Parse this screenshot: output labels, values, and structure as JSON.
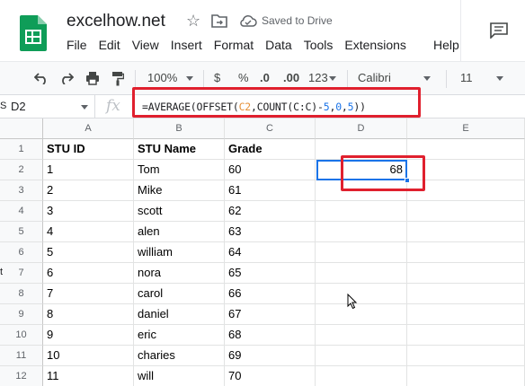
{
  "app": {
    "doc_title": "excelhow.net",
    "save_status": "Saved to Drive"
  },
  "menu": [
    "File",
    "Edit",
    "View",
    "Insert",
    "Format",
    "Data",
    "Tools",
    "Extensions"
  ],
  "menu_help": "Help",
  "toolbar": {
    "zoom": "100%",
    "currency": "$",
    "percent": "%",
    "decrease_decimal": ".0",
    "increase_decimal": ".00",
    "number_format": "123",
    "font": "Calibri",
    "font_size": "11"
  },
  "formula_bar": {
    "name_box": "D2",
    "fx": "fx",
    "formula_parts": {
      "p1": "=AVERAGE(OFFSET(",
      "p2": "C2",
      "p3": ",COUNT(C:C)-",
      "p4": "5",
      "p5": ",",
      "p6": "0",
      "p7": ",",
      "p8": "5",
      "p9": "))"
    }
  },
  "columns": [
    "A",
    "B",
    "C",
    "D",
    "E"
  ],
  "rows": [
    "1",
    "2",
    "3",
    "4",
    "5",
    "6",
    "7",
    "8",
    "9",
    "10",
    "11",
    "12"
  ],
  "cells": [
    [
      "STU ID",
      "STU Name",
      "Grade",
      "",
      ""
    ],
    [
      "1",
      "Tom",
      "60",
      "68",
      ""
    ],
    [
      "2",
      "Mike",
      "61",
      "",
      ""
    ],
    [
      "3",
      "scott",
      "62",
      "",
      ""
    ],
    [
      "4",
      "alen",
      "63",
      "",
      ""
    ],
    [
      "5",
      "william",
      "64",
      "",
      ""
    ],
    [
      "6",
      "nora",
      "65",
      "",
      ""
    ],
    [
      "7",
      "carol",
      "66",
      "",
      ""
    ],
    [
      "8",
      "daniel",
      "67",
      "",
      ""
    ],
    [
      "9",
      "eric",
      "68",
      "",
      ""
    ],
    [
      "10",
      "charies",
      "69",
      "",
      ""
    ],
    [
      "11",
      "will",
      "70",
      "",
      ""
    ]
  ],
  "edge_fragments": {
    "s": "S",
    "t": "t"
  },
  "colors": {
    "accent": "#1a73e8",
    "annotation": "#e0202e",
    "sheets_green": "#0f9d58",
    "formula_ref": "#e69138"
  }
}
